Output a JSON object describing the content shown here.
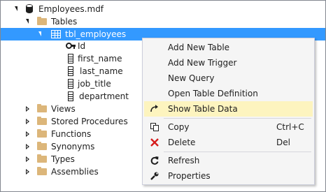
{
  "tree": {
    "root": {
      "label": "Employees.mdf",
      "icon": "database-icon"
    },
    "tables": {
      "label": "Tables",
      "icon": "folder-icon"
    },
    "selected_table": {
      "label": "tbl_employees",
      "icon": "table-icon"
    },
    "columns": [
      {
        "label": "Id",
        "icon": "primary-key-icon"
      },
      {
        "label": "first_name",
        "icon": "column-icon"
      },
      {
        "label": "last_name",
        "icon": "column-icon"
      },
      {
        "label": "job_title",
        "icon": "column-icon"
      },
      {
        "label": "department",
        "icon": "column-icon"
      }
    ],
    "folders": [
      {
        "label": "Views"
      },
      {
        "label": "Stored Procedures"
      },
      {
        "label": "Functions"
      },
      {
        "label": "Synonyms"
      },
      {
        "label": "Types"
      },
      {
        "label": "Assemblies"
      }
    ]
  },
  "context_menu": {
    "items": [
      {
        "label": "Add New Table",
        "shortcut": "",
        "icon": ""
      },
      {
        "label": "Add New Trigger",
        "shortcut": "",
        "icon": ""
      },
      {
        "label": "New Query",
        "shortcut": "",
        "icon": ""
      },
      {
        "label": "Open Table Definition",
        "shortcut": "",
        "icon": ""
      },
      {
        "label": "Show Table Data",
        "shortcut": "",
        "icon": "show-data-arrow-icon",
        "highlighted": true
      },
      {
        "label": "Copy",
        "shortcut": "Ctrl+C",
        "icon": "copy-icon"
      },
      {
        "label": "Delete",
        "shortcut": "Del",
        "icon": "delete-x-icon"
      },
      {
        "label": "Refresh",
        "shortcut": "",
        "icon": "refresh-icon"
      },
      {
        "label": "Properties",
        "shortcut": "",
        "icon": "wrench-icon"
      }
    ]
  },
  "colors": {
    "selection": "#3399ff",
    "menu_highlight": "#fdf4bf",
    "folder": "#dcb67a",
    "delete_icon": "#d61c1c"
  }
}
